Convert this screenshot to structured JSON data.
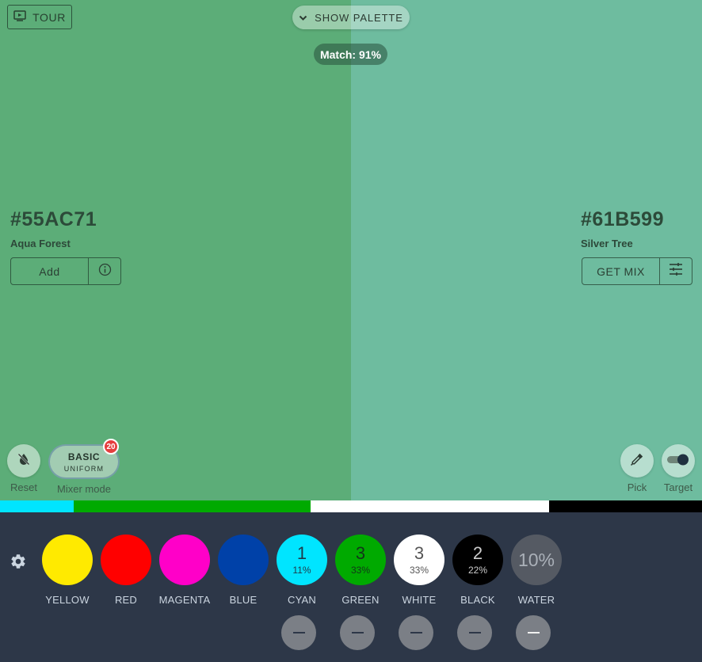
{
  "colors": {
    "mix": "#5CAD78",
    "target": "#6EBC9F",
    "panel": "#2d3748"
  },
  "header": {
    "tour_label": "TOUR",
    "tour_icon": "play-screen-icon",
    "palette_label": "SHOW PALETTE",
    "palette_icon": "chevron-down-icon",
    "match_label": "Match: 91%"
  },
  "mix_color": {
    "hex": "#55AC71",
    "name": "Aqua Forest",
    "add_label": "Add",
    "info_icon": "info-icon"
  },
  "target_color": {
    "hex": "#61B599",
    "name": "Silver Tree",
    "get_mix_label": "GET MIX",
    "tune_icon": "sliders-icon"
  },
  "controls": {
    "reset_label": "Reset",
    "reset_icon": "no-drop-icon",
    "mode_title": "BASIC",
    "mode_sub": "UNIFORM",
    "mode_badge": "20",
    "mode_label": "Mixer mode",
    "pick_label": "Pick",
    "pick_icon": "eyedropper-icon",
    "target_label": "Target",
    "target_icon": "toggle-icon"
  },
  "proportion_bar": [
    {
      "color": "#00e5ff",
      "fraction": 0.105
    },
    {
      "color": "#00aa00",
      "fraction": 0.338
    },
    {
      "color": "#ffffff",
      "fraction": 0.339
    },
    {
      "color": "#000000",
      "fraction": 0.218
    }
  ],
  "paints": [
    {
      "name": "YELLOW",
      "color": "#ffea00",
      "count": "",
      "pct": "",
      "text_color": "#000000",
      "minus": false
    },
    {
      "name": "RED",
      "color": "#ff0000",
      "count": "",
      "pct": "",
      "text_color": "#000000",
      "minus": false
    },
    {
      "name": "MAGENTA",
      "color": "#ff00c8",
      "count": "",
      "pct": "",
      "text_color": "#000000",
      "minus": false
    },
    {
      "name": "BLUE",
      "color": "#0041a8",
      "count": "",
      "pct": "",
      "text_color": "#ffffff",
      "minus": false
    },
    {
      "name": "CYAN",
      "color": "#00e5ff",
      "count": "1",
      "pct": "11%",
      "text_color": "#1f3a4a",
      "minus": true
    },
    {
      "name": "GREEN",
      "color": "#00aa00",
      "count": "3",
      "pct": "33%",
      "text_color": "#12361a",
      "minus": true
    },
    {
      "name": "WHITE",
      "color": "#ffffff",
      "count": "3",
      "pct": "33%",
      "text_color": "#555555",
      "minus": true
    },
    {
      "name": "BLACK",
      "color": "#000000",
      "count": "2",
      "pct": "22%",
      "text_color": "#cccccc",
      "minus": true
    },
    {
      "name": "WATER",
      "color": "#555a63",
      "count": "10%",
      "pct": "",
      "text_color": "#aab0b8",
      "minus": true
    }
  ],
  "settings_icon": "gear-icon"
}
